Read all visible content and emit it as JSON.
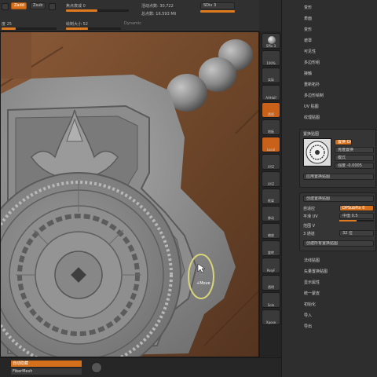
{
  "topbar": {
    "row1": {
      "zadd": "Zadd",
      "zsub": "Zsub",
      "focal_label": "焦点衰减 0",
      "active_points": "活动点数: 30,722",
      "total_points": "总点数: 16.593 Mil",
      "sdiv_label": "SDiv 3"
    },
    "row2": {
      "rgb_label": "度 25",
      "draw_size_label": "绘制大小 52",
      "dynamic_label": "Dynamic"
    },
    "accent": "#e07a1e"
  },
  "viewport": {
    "cursor_label": "+Move",
    "colors": {
      "wood": "#7a5236",
      "clay": "#8f8f8f",
      "ring": "#d8d47a"
    }
  },
  "shelf": {
    "tools": [
      {
        "name": "sphere",
        "label": "SPix 3"
      },
      {
        "name": "zoom",
        "label": "100%"
      },
      {
        "name": "actual",
        "label": "实际"
      },
      {
        "name": "aahalf",
        "label": "AAHalf"
      },
      {
        "name": "persp",
        "label": "透视"
      },
      {
        "name": "floor",
        "label": "地板"
      },
      {
        "name": "local",
        "label": "Local"
      },
      {
        "name": "xyz",
        "label": "XYZ"
      },
      {
        "name": "rotate",
        "label": "XYZ"
      },
      {
        "name": "frame",
        "label": "框架"
      },
      {
        "name": "move",
        "label": "移动"
      },
      {
        "name": "scale",
        "label": "缩放"
      },
      {
        "name": "rot3d",
        "label": "旋转"
      },
      {
        "name": "polyf",
        "label": "PolyF"
      },
      {
        "name": "transp",
        "label": "透明"
      },
      {
        "name": "solo",
        "label": "Solo"
      },
      {
        "name": "xpose",
        "label": "Xpose"
      }
    ]
  },
  "panel": {
    "menu_top": [
      "变形",
      "表面",
      "变形",
      "遮罩",
      "可见性",
      "多边形组",
      "接触",
      "重新拓扑",
      "多边形绘制",
      "UV 贴图",
      "纹理贴图"
    ],
    "section_title": "置换贴图",
    "displace_label": "置换 On",
    "create_label": "克隆置换",
    "mode_label": "模式",
    "intensity_label": "强度 -0.0005",
    "apply_label": "应用置换贴图",
    "subtitle2": "创建置换贴图",
    "smooth_label": "平滑 UV",
    "adaptive_label": "自适应",
    "dpsubpix_label": "DPSubPix 0",
    "range_label": "范围 V",
    "uv_label": "平滑 UV",
    "mid_label": "中值 0.5",
    "bits_label": "32 位",
    "channel_label": "3 通道",
    "create_all_label": "创建所有置换贴图",
    "menu_bottom": [
      "法线贴图",
      "矢量置换贴图",
      "显示属性",
      "统一蒙皮",
      "初始化",
      "导入",
      "导出"
    ]
  },
  "bottombar": {
    "btn1": "自动隐藏",
    "btn2": "FiberMesh"
  }
}
